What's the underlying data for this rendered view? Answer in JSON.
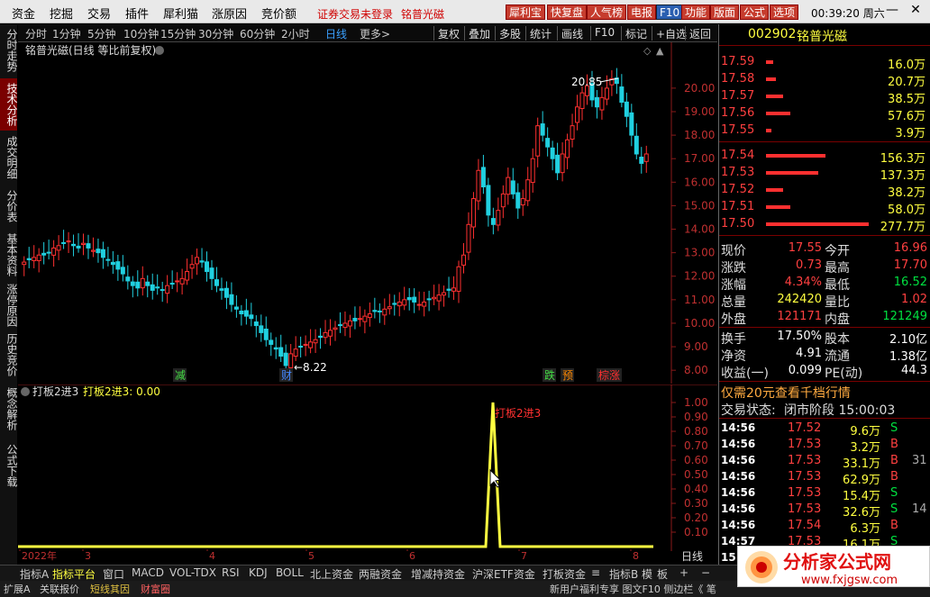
{
  "menu": {
    "items": [
      "资金",
      "挖掘",
      "交易",
      "插件",
      "犀利猫",
      "涨原因",
      "竞价额"
    ],
    "warning": "证券交易未登录",
    "stock": "铭普光磁",
    "tool_buttons": [
      "犀利宝",
      "快复盘",
      "人气榜",
      "电报",
      "F10",
      "功能",
      "版面",
      "公式",
      "选项"
    ],
    "clock": "00:39:20 周六",
    "win_min": "—",
    "win_close": "✕"
  },
  "sidebar": {
    "tabs": [
      "分时走势",
      "技术分析",
      "成交明细",
      "分价表",
      "基本资料",
      "涨停原因",
      "历史竞价",
      "概念解析",
      "公式下载"
    ],
    "active": 1
  },
  "period": {
    "items": [
      "分时",
      "1分钟",
      "5分钟",
      "10分钟",
      "15分钟",
      "30分钟",
      "60分钟",
      "2小时",
      "日线",
      "更多>"
    ],
    "selected": 8,
    "tools": [
      "复权",
      "叠加",
      "多股",
      "统计",
      "画线",
      "F10",
      "标记",
      "+自选",
      "返回"
    ]
  },
  "kline": {
    "title": "铭普光磁(日线 等比前复权)",
    "high_label": "20.85",
    "low_label": "8.22",
    "markers": [
      "减",
      "财",
      "跌",
      "预",
      "棕涨"
    ],
    "price_axis": [
      "20.00",
      "19.00",
      "18.00",
      "17.00",
      "16.00",
      "15.00",
      "14.00",
      "13.00",
      "12.00",
      "11.00",
      "10.00",
      "9.00",
      "8.00"
    ]
  },
  "indicator": {
    "name": "打板2进3",
    "value_label": "打板2进3: 0.00",
    "signal_label": "打板2进3",
    "axis": [
      "1.00",
      "0.90",
      "0.80",
      "0.70",
      "0.60",
      "0.50",
      "0.40",
      "0.30",
      "0.20",
      "0.10"
    ],
    "x_axis": [
      "2022年",
      "3",
      "4",
      "5",
      "6",
      "7",
      "8"
    ],
    "period_label": "日线"
  },
  "quote": {
    "code": "002902",
    "name": "铭普光磁",
    "asks": [
      {
        "price": "17.59",
        "vol": "16.0万",
        "bar": 0.04
      },
      {
        "price": "17.58",
        "vol": "20.7万",
        "bar": 0.06
      },
      {
        "price": "17.57",
        "vol": "38.5万",
        "bar": 0.14
      },
      {
        "price": "17.56",
        "vol": "57.6万",
        "bar": 0.21
      },
      {
        "price": "17.55",
        "vol": "3.9万",
        "bar": 0.02
      }
    ],
    "bids": [
      {
        "price": "17.54",
        "vol": "156.3万",
        "bar": 0.56
      },
      {
        "price": "17.53",
        "vol": "137.3万",
        "bar": 0.49
      },
      {
        "price": "17.52",
        "vol": "38.2万",
        "bar": 0.14
      },
      {
        "price": "17.51",
        "vol": "58.0万",
        "bar": 0.21
      },
      {
        "price": "17.50",
        "vol": "277.7万",
        "bar": 1.0
      }
    ],
    "stats": [
      {
        "l1": "现价",
        "v1": "17.55",
        "c1": "#ff4040",
        "l2": "今开",
        "v2": "16.96",
        "c2": "#ff4040"
      },
      {
        "l1": "涨跌",
        "v1": "0.73",
        "c1": "#ff4040",
        "l2": "最高",
        "v2": "17.70",
        "c2": "#ff4040"
      },
      {
        "l1": "涨幅",
        "v1": "4.34%",
        "c1": "#ff4040",
        "l2": "最低",
        "v2": "16.52",
        "c2": "#00e040"
      },
      {
        "l1": "总量",
        "v1": "242420",
        "c1": "#ffff40",
        "l2": "量比",
        "v2": "1.02",
        "c2": "#ff4040"
      },
      {
        "l1": "外盘",
        "v1": "121171",
        "c1": "#ff4040",
        "l2": "内盘",
        "v2": "121249",
        "c2": "#00e040"
      },
      {
        "l1": "换手",
        "v1": "17.50%",
        "c1": "#fff",
        "l2": "股本",
        "v2": "2.10亿",
        "c2": "#fff"
      },
      {
        "l1": "净资",
        "v1": "4.91",
        "c1": "#fff",
        "l2": "流通",
        "v2": "1.38亿",
        "c2": "#fff"
      },
      {
        "l1": "收益(一)",
        "v1": "0.099",
        "c1": "#fff",
        "l2": "PE(动)",
        "v2": "44.3",
        "c2": "#fff"
      }
    ],
    "promo": "仅需20元查看千档行情",
    "status_label": "交易状态:",
    "status_value": "闭市阶段 15:00:03",
    "trades": [
      {
        "t": "14:56",
        "p": "17.52",
        "v": "9.6万",
        "s": "S",
        "n": ""
      },
      {
        "t": "14:56",
        "p": "17.53",
        "v": "3.2万",
        "s": "B",
        "n": ""
      },
      {
        "t": "14:56",
        "p": "17.53",
        "v": "33.1万",
        "s": "B",
        "n": "31"
      },
      {
        "t": "14:56",
        "p": "17.53",
        "v": "62.9万",
        "s": "B",
        "n": ""
      },
      {
        "t": "14:56",
        "p": "17.53",
        "v": "15.4万",
        "s": "S",
        "n": ""
      },
      {
        "t": "14:56",
        "p": "17.53",
        "v": "32.6万",
        "s": "S",
        "n": "14"
      },
      {
        "t": "14:56",
        "p": "17.54",
        "v": "6.3万",
        "s": "B",
        "n": ""
      },
      {
        "t": "14:57",
        "p": "17.53",
        "v": "16.1万",
        "s": "S",
        "n": ""
      },
      {
        "t": "15:0",
        "p": "",
        "v": "",
        "s": "",
        "n": ""
      }
    ]
  },
  "bottom": {
    "tabs": [
      "指标A",
      "指标平台",
      "窗口",
      "MACD",
      "VOL-TDX",
      "RSI",
      "KDJ",
      "BOLL",
      "北上资金",
      "两融资金",
      "增减持资金",
      "沪深ETF资金",
      "打板资金",
      "≡",
      "指标B",
      "模",
      "板",
      "+",
      "−"
    ]
  },
  "status": {
    "left": [
      "扩展A",
      "关联报价",
      "短线其因",
      "财富圈"
    ],
    "right": "新用户福利专享 图文F10 侧边栏《 笔"
  },
  "watermark": {
    "text": "分析家公式网",
    "url": "www.fxjgsw.com"
  }
}
